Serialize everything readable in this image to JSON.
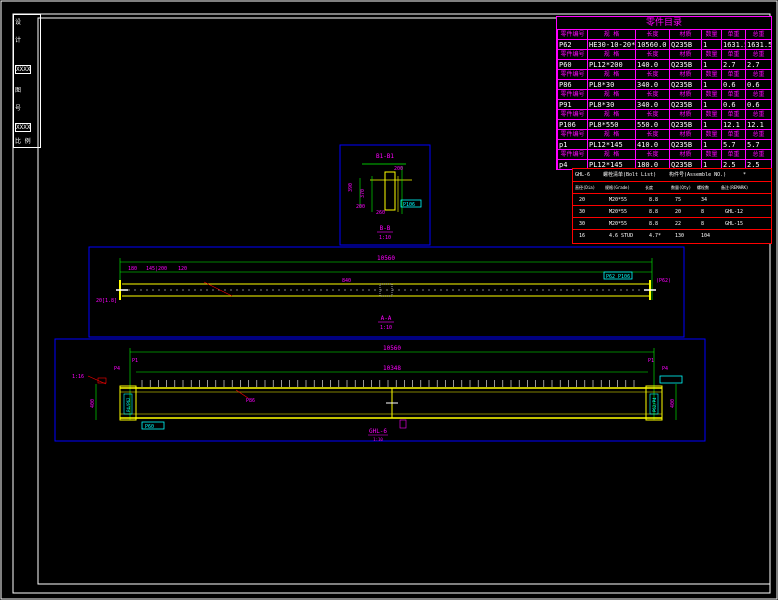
{
  "parts_table": {
    "title": "零件目录",
    "sub_header": [
      "零件编号",
      "规 格",
      "长度",
      "材质",
      "数量",
      "单重",
      "总重"
    ],
    "rows": [
      [
        "P62",
        "HE30-10-20*300",
        "10560.0",
        "Q235B",
        "1",
        "1631.5",
        "1631.5"
      ],
      [
        "P60",
        "PL12*200",
        "140.0",
        "Q235B",
        "1",
        "2.7",
        "2.7"
      ],
      [
        "P86",
        "PL8*30",
        "340.0",
        "Q235B",
        "1",
        "0.6",
        "0.6"
      ],
      [
        "P91",
        "PL8*30",
        "340.0",
        "Q235B",
        "1",
        "0.6",
        "0.6"
      ],
      [
        "P106",
        "PL8*550",
        "550.0",
        "Q235B",
        "1",
        "12.1",
        "12.1"
      ],
      [
        "p1",
        "PL12*145",
        "410.0",
        "Q235B",
        "1",
        "5.7",
        "5.7"
      ],
      [
        "p4",
        "PL12*145",
        "180.0",
        "Q235B",
        "1",
        "2.5",
        "2.5"
      ]
    ]
  },
  "bolt_table": {
    "title_left": "GHL-6",
    "title_mid": "螺栓清单(Bolt List)",
    "title_right": "构件号(Assemble NO.)",
    "title_star": "*",
    "headers": [
      "直径(Dia)",
      "规格(Grade)",
      "长度",
      "数量(Qty)",
      "螺栓数",
      "备注(REMARK)"
    ],
    "rows": [
      [
        "20",
        "M20*55",
        "8.8",
        "75",
        "34",
        ""
      ],
      [
        "30",
        "M20*55",
        "8.8",
        "20",
        "8",
        "GHL-12"
      ],
      [
        "30",
        "M20*55",
        "8.8",
        "22",
        "8",
        "GHL-15"
      ],
      [
        "16",
        "4.6 STUD",
        "4.7*",
        "130",
        "104",
        ""
      ]
    ]
  },
  "titleblock": {
    "labels": [
      "设",
      "计",
      "XXXX",
      "图",
      "号",
      "XXXX",
      "比 例"
    ]
  },
  "section_view": {
    "top_label": "B1-B1",
    "dims": [
      "200",
      "390",
      "370",
      "260",
      "200"
    ],
    "tag": "P106",
    "caption": "B-B",
    "scale": "1:10"
  },
  "top_view": {
    "overall": "10560",
    "left_tag": "20[1.8]",
    "segments": [
      "180",
      "145|200",
      "120",
      "840"
    ],
    "right_tag": "(P62)",
    "mid_tag": "P62 P106",
    "caption": "A-A",
    "scale": "1:10"
  },
  "elevation_view": {
    "overall": "10560",
    "inner": "10348",
    "left_tags": [
      "P1",
      "P4"
    ],
    "right_tags": [
      "P4",
      "P1"
    ],
    "mid_tag": "P60",
    "label_left": "1:16",
    "left_box": "P4/P62",
    "right_box": "P62/P4",
    "bottom_tag": "P86",
    "bottom_label": "GHL-6",
    "scale": "1:10",
    "left_dim": "400",
    "right_dim": "400"
  },
  "colors": {
    "background": "#000000",
    "frame": "#ffffff",
    "viewport_border": "#0000ff",
    "dimension": "#00ff00",
    "annotation": "#ff00ff",
    "beam": "#ffff00",
    "leader": "#ff0000",
    "tag_box": "#00ffff"
  }
}
